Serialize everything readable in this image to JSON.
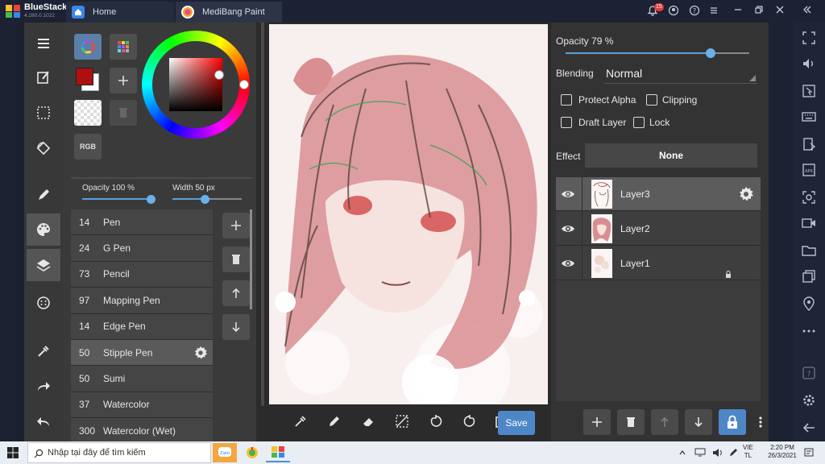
{
  "titlebar": {
    "brand": "BlueStacks",
    "version": "4.280.0.1022",
    "tabs": [
      {
        "label": "Home",
        "icon": "home-icon"
      },
      {
        "label": "MediBang Paint",
        "icon": "medibang-icon"
      }
    ],
    "notification_count": "15",
    "icons": [
      "bell-icon",
      "account-icon",
      "help-icon",
      "menu-icon",
      "minimize-icon",
      "restore-icon",
      "close-icon",
      "collapse-icon"
    ]
  },
  "left_toolbar": {
    "items": [
      "menu-icon",
      "edit-icon",
      "selection-icon",
      "rotate-icon",
      "brush-icon",
      "palette-icon",
      "layers-icon",
      "material-icon",
      "eyedropper-icon",
      "redo-icon",
      "undo-icon"
    ]
  },
  "brush_panel": {
    "rgb_label": "RGB",
    "colors": {
      "primary": "#b00f0f",
      "secondary": "#ffffff"
    },
    "opacity_label": "Opacity 100 %",
    "opacity_value": 1.0,
    "width_label": "Width 50 px",
    "width_fraction": 0.46,
    "brushes": [
      {
        "size": "14",
        "name": "Pen"
      },
      {
        "size": "24",
        "name": "G Pen"
      },
      {
        "size": "73",
        "name": "Pencil"
      },
      {
        "size": "97",
        "name": "Mapping Pen"
      },
      {
        "size": "14",
        "name": "Edge Pen"
      },
      {
        "size": "50",
        "name": "Stipple Pen",
        "selected": true
      },
      {
        "size": "50",
        "name": "Sumi"
      },
      {
        "size": "37",
        "name": "Watercolor"
      },
      {
        "size": "300",
        "name": "Watercolor (Wet)"
      }
    ]
  },
  "canvas_toolbar": {
    "tools": [
      "eyedropper-icon",
      "pen-icon",
      "eraser-icon",
      "deselect-icon",
      "rotate-left-icon",
      "rotate-right-icon",
      "transform-icon"
    ],
    "save_label": "Save"
  },
  "layer_panel": {
    "opacity_label": "Opacity 79 %",
    "opacity_value": 0.79,
    "blending_label": "Blending",
    "blending_value": "Normal",
    "checkboxes": {
      "protect_alpha": "Protect Alpha",
      "clipping": "Clipping",
      "draft_layer": "Draft Layer",
      "lock": "Lock"
    },
    "effect_label": "Effect",
    "effect_value": "None",
    "layers": [
      {
        "name": "Layer3",
        "selected": true
      },
      {
        "name": "Layer2"
      },
      {
        "name": "Layer1",
        "locked": true
      }
    ],
    "actions": [
      "add-layer-icon",
      "delete-layer-icon",
      "move-up-icon",
      "move-down-icon",
      "lock-icon",
      "more-icon"
    ]
  },
  "right_bar": {
    "icons": [
      "expand-icon",
      "volume-icon",
      "cursor-icon",
      "keyboard-icon",
      "install-apk-icon",
      "apk-icon",
      "screenshot-icon",
      "record-icon",
      "folder-icon",
      "multi-instance-icon",
      "location-icon",
      "more-icon",
      "help-icon",
      "settings-icon",
      "back-icon"
    ]
  },
  "taskbar": {
    "search_placeholder": "Nhập tại đây để tìm kiếm",
    "apps": [
      "zalo-icon",
      "app-icon",
      "bluestacks-icon"
    ],
    "lang_top": "VIE",
    "lang_bottom": "TL",
    "time": "2:20 PM",
    "date": "26/3/2021"
  }
}
